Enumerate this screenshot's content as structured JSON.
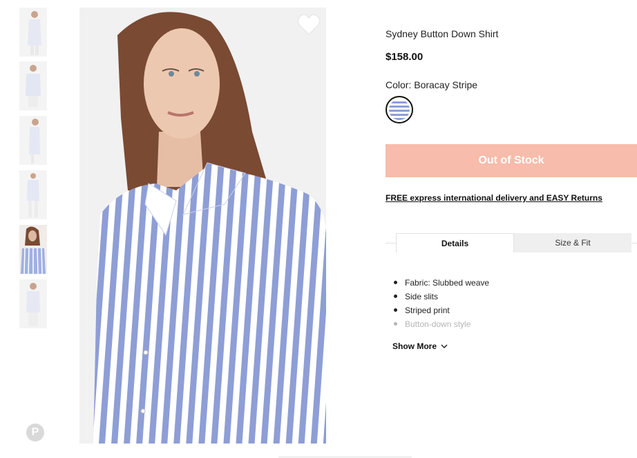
{
  "product": {
    "brand": "",
    "title": "Sydney Button Down Shirt",
    "price": "$158.00",
    "color_label": "Color: Boracay Stripe",
    "swatch_colors": [
      "#8e9ed6",
      "#ffffff"
    ]
  },
  "actions": {
    "out_of_stock_label": "Out of Stock",
    "delivery_link": "FREE express international delivery and EASY Returns"
  },
  "tabs": [
    {
      "label": "Details",
      "active": true
    },
    {
      "label": "Size & Fit",
      "active": false
    }
  ],
  "details": {
    "features": [
      "Fabric: Slubbed weave",
      "Side slits",
      "Striped print",
      "Button-down style"
    ],
    "show_more_label": "Show More"
  },
  "gallery": {
    "thumbnail_count": 6,
    "active_thumbnail": 5
  },
  "icons": {
    "favorite": "heart-icon",
    "share": "pinterest-icon",
    "expand": "chevron-down-icon"
  },
  "colors": {
    "button_bg": "#f7bcab",
    "stripe_blue": "#8e9ed6"
  }
}
